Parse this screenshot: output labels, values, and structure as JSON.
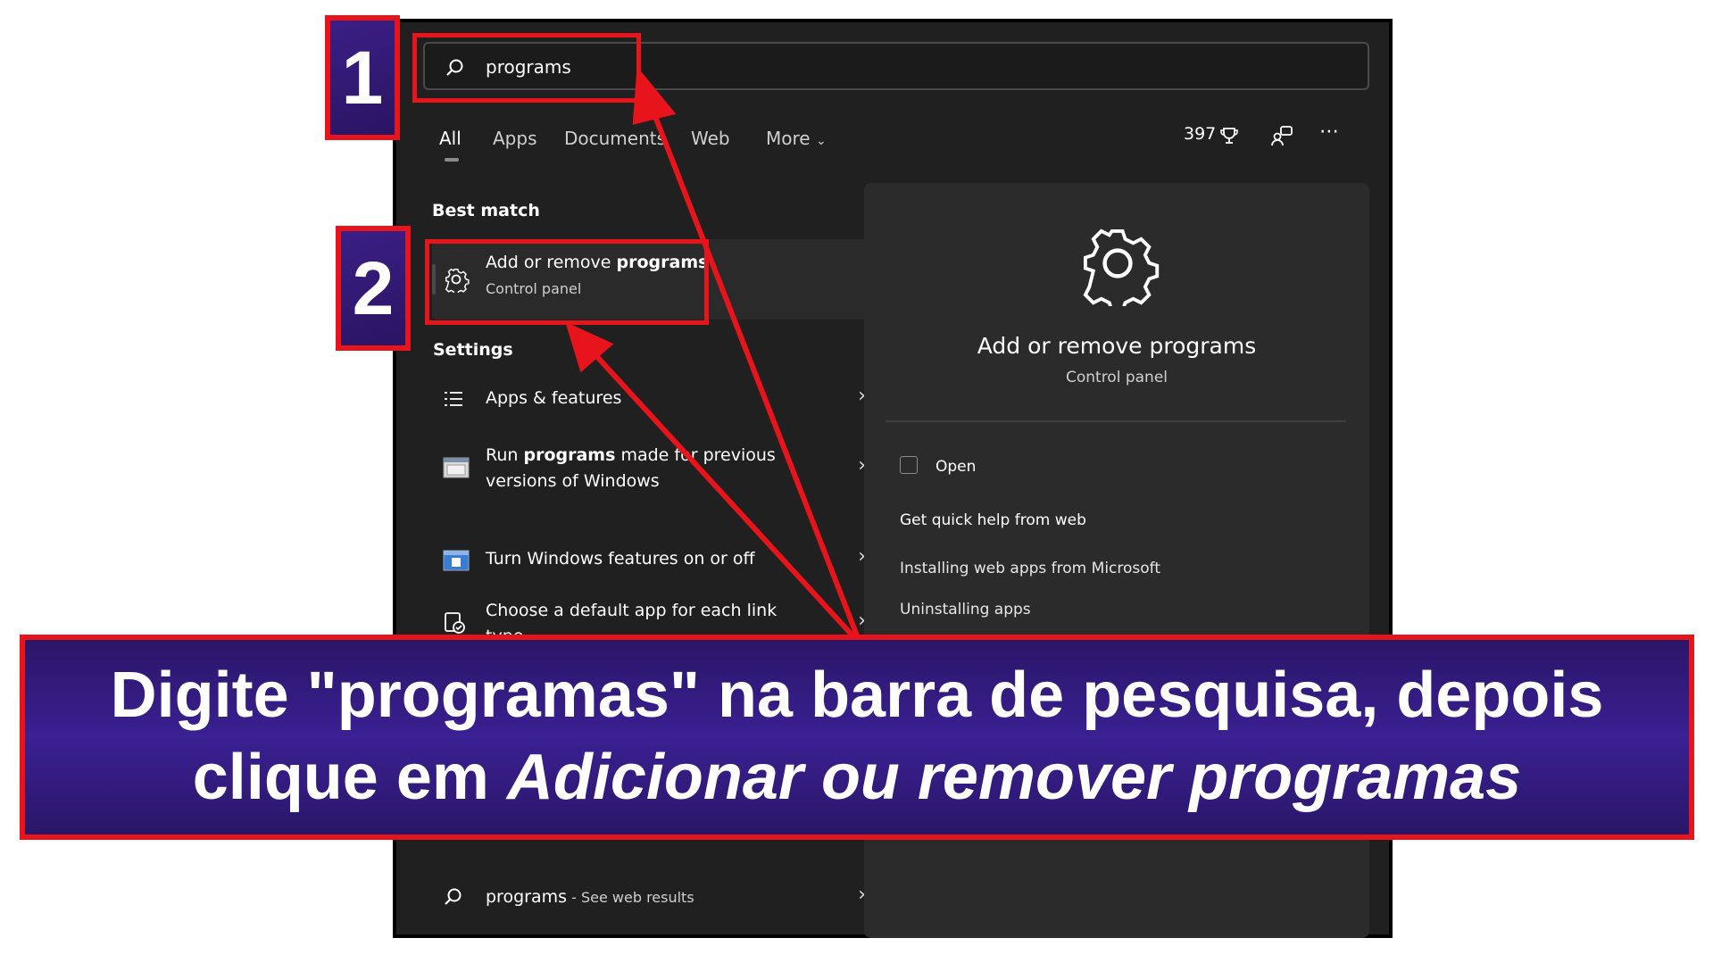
{
  "search": {
    "value": "programs"
  },
  "tabs": [
    {
      "label": "All"
    },
    {
      "label": "Apps"
    },
    {
      "label": "Documents"
    },
    {
      "label": "Web"
    },
    {
      "label": "More"
    }
  ],
  "toolbar": {
    "points": "397"
  },
  "best_match": {
    "heading": "Best match",
    "title_prefix": "Add or remove ",
    "title_bold": "programs",
    "subtitle": "Control panel"
  },
  "settings": {
    "heading": "Settings",
    "items": [
      {
        "line1": "Apps & features",
        "line2": ""
      },
      {
        "line1_prefix": "Run ",
        "line1_bold": "programs",
        "line1_suffix": " made for previous",
        "line2": "versions of Windows"
      },
      {
        "line1": "Turn Windows features on or off",
        "line2": ""
      },
      {
        "line1": "Choose a default app for each link",
        "line2": "type"
      }
    ]
  },
  "web_result": {
    "term": "programs",
    "suffix": " - See web results"
  },
  "preview": {
    "title": "Add or remove programs",
    "subtitle": "Control panel",
    "open_label": "Open",
    "help_heading": "Get quick help from web",
    "links": [
      "Installing web apps from Microsoft",
      "Uninstalling apps"
    ]
  },
  "annotations": {
    "step1": "1",
    "step2": "2",
    "banner_line1": "Digite \"programas\" na barra de pesquisa, depois",
    "banner_line2_prefix": "clique em ",
    "banner_line2_italic": "Adicionar ou remover programas"
  },
  "colors": {
    "annotation_red": "#e8141b",
    "annotation_purple": "#2a1668",
    "panel_bg": "#202020"
  },
  "icons": [
    "search-icon",
    "gear-icon",
    "list-icon",
    "window-icon",
    "default-app-icon",
    "trophy-icon",
    "share-icon",
    "more-icon",
    "open-external-icon",
    "chevron-right-icon",
    "chevron-down-icon"
  ]
}
